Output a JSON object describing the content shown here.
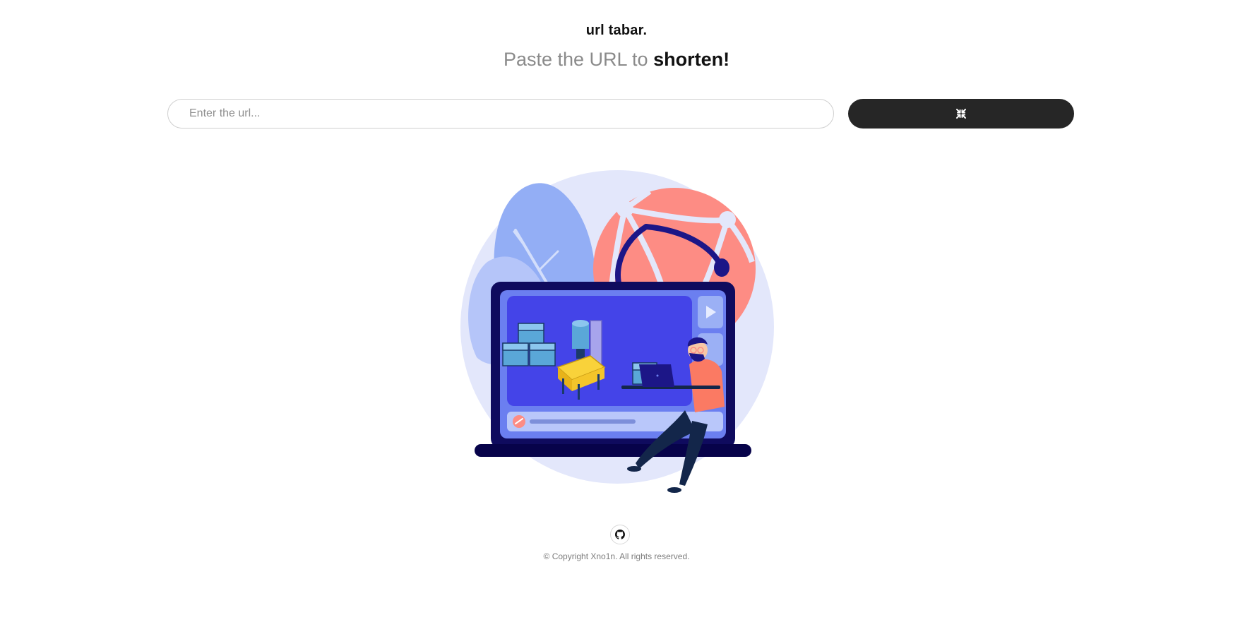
{
  "header": {
    "brand": "url tabar.",
    "tagline_prefix": "Paste the URL to ",
    "tagline_emphasis": "shorten!"
  },
  "form": {
    "url_placeholder": "Enter the url...",
    "url_value": "",
    "submit_icon": "compress-arrows-icon"
  },
  "illustration": {
    "icon": "laptop-video-illustration"
  },
  "footer": {
    "github_icon": "github-icon",
    "copyright": "© Copyright Xno1n. All rights reserved."
  },
  "colors": {
    "button_bg": "#262626",
    "muted_text": "#8a8a8a",
    "illustration_bg": "#e3e7fb",
    "leaf_blue": "#93aef5",
    "ball_red": "#fd8c84",
    "laptop_frame": "#0f0b5e",
    "screen_blue": "#4444e8",
    "accent_yellow": "#f9d23a"
  }
}
